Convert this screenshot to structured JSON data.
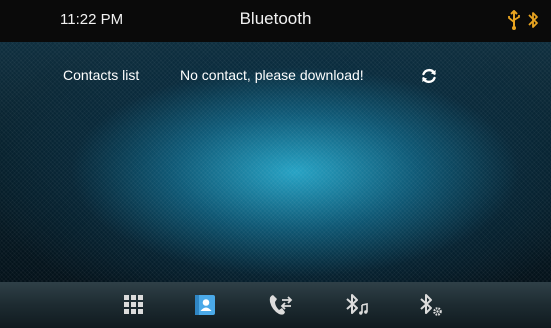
{
  "status": {
    "time": "11:22 PM",
    "title": "Bluetooth"
  },
  "contacts": {
    "label": "Contacts list",
    "message": "No contact, please download!"
  },
  "icons": {
    "usb": "usb-icon",
    "bluetooth_status": "bluetooth-icon",
    "refresh": "refresh-icon",
    "dialpad": "dialpad-icon",
    "contacts": "contacts-icon",
    "call_log": "call-log-icon",
    "bt_music": "bluetooth-music-icon",
    "bt_settings": "bluetooth-settings-icon"
  },
  "colors": {
    "accent": "#e8a421",
    "selected": "#4aa9e8",
    "dock_icon": "#dcdcdc"
  }
}
